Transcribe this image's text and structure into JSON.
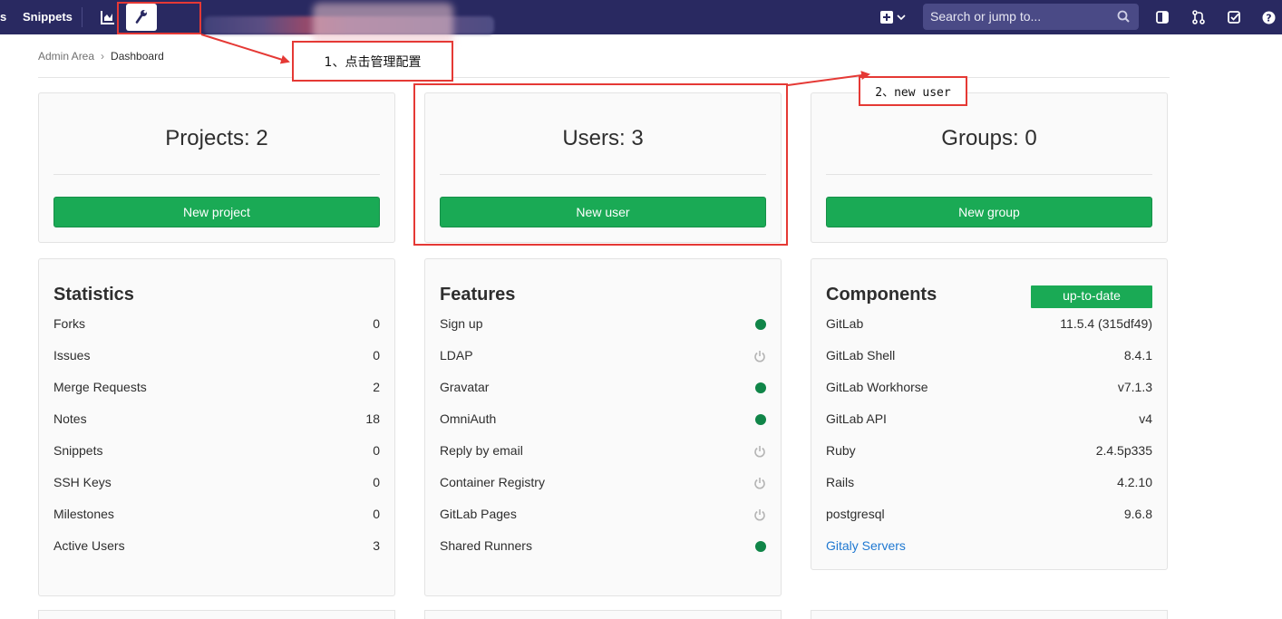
{
  "navbar": {
    "partial_left_label": "s",
    "snippets_label": "Snippets",
    "search_placeholder": "Search or jump to...",
    "icons": [
      "chart-icon",
      "wrench-icon",
      "plus-icon",
      "chevron-down-icon",
      "search-icon",
      "sidebar-toggle-icon",
      "merge-request-icon",
      "todo-check-icon",
      "help-icon"
    ]
  },
  "breadcrumb": {
    "parent": "Admin Area",
    "current": "Dashboard"
  },
  "counts": [
    {
      "title": "Projects: 2",
      "button": "New project"
    },
    {
      "title": "Users: 3",
      "button": "New user"
    },
    {
      "title": "Groups: 0",
      "button": "New group"
    }
  ],
  "statistics": {
    "title": "Statistics",
    "rows": [
      {
        "label": "Forks",
        "value": "0"
      },
      {
        "label": "Issues",
        "value": "0"
      },
      {
        "label": "Merge Requests",
        "value": "2"
      },
      {
        "label": "Notes",
        "value": "18"
      },
      {
        "label": "Snippets",
        "value": "0"
      },
      {
        "label": "SSH Keys",
        "value": "0"
      },
      {
        "label": "Milestones",
        "value": "0"
      },
      {
        "label": "Active Users",
        "value": "3"
      }
    ]
  },
  "features": {
    "title": "Features",
    "rows": [
      {
        "label": "Sign up",
        "state": "on"
      },
      {
        "label": "LDAP",
        "state": "off"
      },
      {
        "label": "Gravatar",
        "state": "on"
      },
      {
        "label": "OmniAuth",
        "state": "on"
      },
      {
        "label": "Reply by email",
        "state": "off"
      },
      {
        "label": "Container Registry",
        "state": "off"
      },
      {
        "label": "GitLab Pages",
        "state": "off"
      },
      {
        "label": "Shared Runners",
        "state": "on"
      }
    ]
  },
  "components": {
    "title": "Components",
    "status_badge": "up-to-date",
    "rows": [
      {
        "label": "GitLab",
        "value": "11.5.4 (315df49)"
      },
      {
        "label": "GitLab Shell",
        "value": "8.4.1"
      },
      {
        "label": "GitLab Workhorse",
        "value": "v7.1.3"
      },
      {
        "label": "GitLab API",
        "value": "v4"
      },
      {
        "label": "Ruby",
        "value": "2.4.5p335"
      },
      {
        "label": "Rails",
        "value": "4.2.10"
      },
      {
        "label": "postgresql",
        "value": "9.6.8"
      }
    ],
    "link": "Gitaly Servers"
  },
  "annotations": {
    "step1": "1、点击管理配置",
    "step2": "2、new user",
    "color": "#e53935"
  },
  "colors": {
    "navbar": "#292961",
    "button_green": "#1aaa55",
    "status_on": "#108548",
    "link_blue": "#1f78d1"
  }
}
